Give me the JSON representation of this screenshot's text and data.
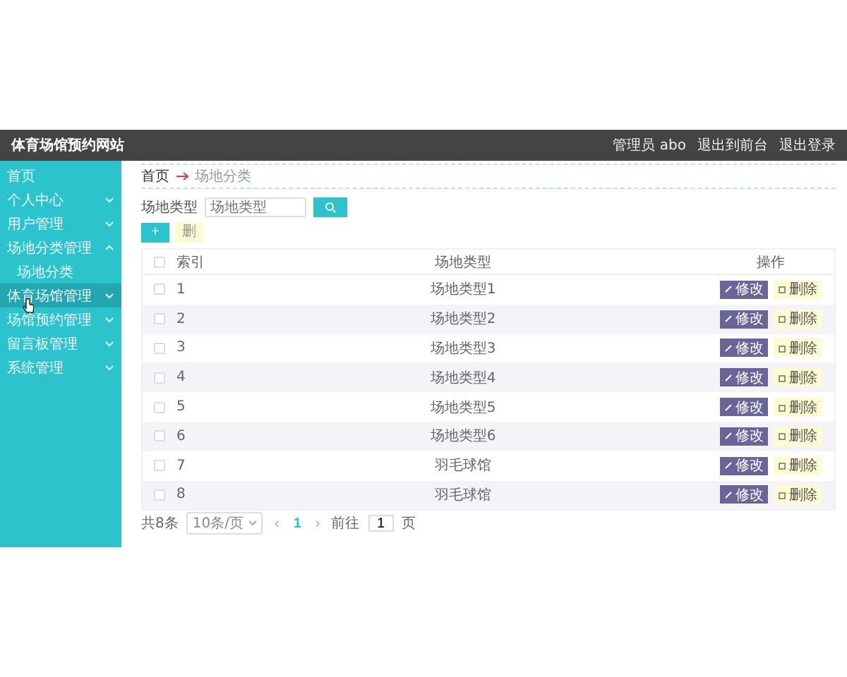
{
  "header": {
    "title": "体育场馆预约网站",
    "links": [
      "管理员 abo",
      "退出到前台",
      "退出登录"
    ]
  },
  "sidebar": {
    "items": [
      {
        "label": "首页",
        "kind": "link",
        "selected": false
      },
      {
        "label": "个人中心",
        "kind": "group",
        "expanded": false,
        "selected": false
      },
      {
        "label": "用户管理",
        "kind": "group",
        "expanded": false,
        "selected": false
      },
      {
        "label": "场地分类管理",
        "kind": "group",
        "expanded": true,
        "selected": false,
        "children": [
          {
            "label": "场地分类",
            "selected": false
          }
        ]
      },
      {
        "label": "体育场馆管理",
        "kind": "group",
        "expanded": false,
        "selected": true
      },
      {
        "label": "场馆预约管理",
        "kind": "group",
        "expanded": false,
        "selected": false
      },
      {
        "label": "留言板管理",
        "kind": "group",
        "expanded": false,
        "selected": false
      },
      {
        "label": "系统管理",
        "kind": "group",
        "expanded": false,
        "selected": false
      }
    ]
  },
  "breadcrumb": [
    "首页",
    "场地分类"
  ],
  "search": {
    "label": "场地类型",
    "placeholder": "场地类型"
  },
  "toolbar": {
    "add": "+",
    "delete": "删"
  },
  "table": {
    "columns": [
      "索引",
      "场地类型",
      "操作"
    ],
    "rows": [
      {
        "index": "1",
        "type": "场地类型1",
        "selected": false,
        "actions": [
          "修改",
          "删除"
        ]
      },
      {
        "index": "2",
        "type": "场地类型2",
        "selected": false,
        "actions": [
          "修改",
          "删除"
        ]
      },
      {
        "index": "3",
        "type": "场地类型3",
        "selected": false,
        "actions": [
          "修改",
          "删除"
        ]
      },
      {
        "index": "4",
        "type": "场地类型4",
        "selected": false,
        "actions": [
          "修改",
          "删除"
        ]
      },
      {
        "index": "5",
        "type": "场地类型5",
        "selected": false,
        "actions": [
          "修改",
          "删除"
        ]
      },
      {
        "index": "6",
        "type": "场地类型6",
        "selected": false,
        "actions": [
          "修改",
          "删除"
        ]
      },
      {
        "index": "7",
        "type": "羽毛球馆",
        "selected": false,
        "actions": [
          "修改",
          "删除"
        ]
      },
      {
        "index": "8",
        "type": "羽毛球馆",
        "selected": false,
        "actions": [
          "修改",
          "删除"
        ]
      }
    ],
    "select_all": {
      "checked": false
    }
  },
  "pagination": {
    "total": "共8条",
    "page_size": "10条/页",
    "prev": "‹",
    "pages": [
      {
        "label": "1",
        "selected": true
      }
    ],
    "next": "›",
    "goto": "前往",
    "goto_value": "1",
    "unit": "页"
  }
}
